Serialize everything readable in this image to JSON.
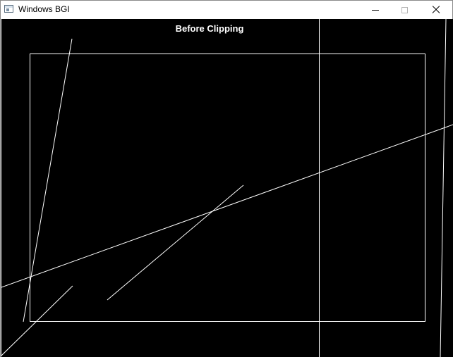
{
  "window": {
    "title": "Windows BGI",
    "icon": "app-window-icon",
    "controls": {
      "minimize_icon": "minimize-icon",
      "maximize_icon": "maximize-icon",
      "close_icon": "close-icon"
    }
  },
  "canvas": {
    "caption": "Before Clipping",
    "background": "#000000",
    "stroke": "#ffffff"
  }
}
